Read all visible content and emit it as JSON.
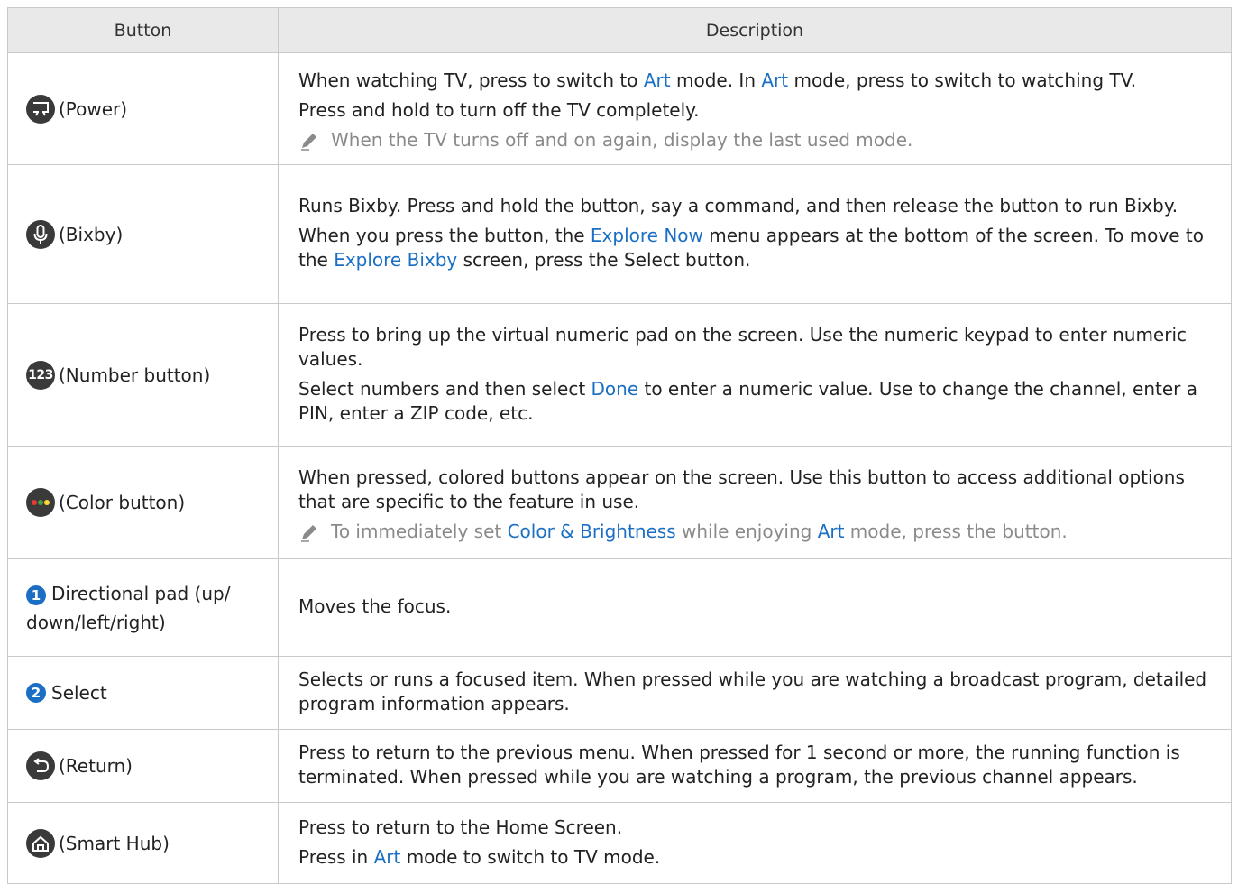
{
  "table": {
    "header": {
      "button": "Button",
      "description": "Description"
    },
    "rows": [
      {
        "button_label": "(Power)",
        "icon": "power-art-icon",
        "desc": [
          {
            "parts": [
              "When watching TV, press to switch to ",
              "Art",
              " mode. In ",
              "Art",
              " mode, press to switch to watching TV."
            ]
          },
          {
            "text": "Press and hold to turn off the TV completely."
          }
        ],
        "note": "When the TV turns off and on again, display the last used mode."
      },
      {
        "button_label": "(Bixby)",
        "icon": "microphone-icon",
        "desc": [
          {
            "text": "Runs Bixby. Press and hold the button, say a command, and then release the button to run Bixby."
          },
          {
            "parts": [
              "When you press the button, the ",
              "Explore Now",
              " menu appears at the bottom of the screen. To move to the ",
              "Explore Bixby",
              " screen, press the Select button."
            ]
          }
        ]
      },
      {
        "button_label": "(Number button)",
        "icon_text": "123",
        "desc": [
          {
            "text": "Press to bring up the virtual numeric pad on the screen. Use the numeric keypad to enter numeric values."
          },
          {
            "parts": [
              "Select numbers and then select ",
              "Done",
              " to enter a numeric value. Use to change the channel, enter a PIN, enter a ZIP code, etc."
            ]
          }
        ]
      },
      {
        "button_label": "(Color button)",
        "icon": "color-dots-icon",
        "desc": [
          {
            "text": "When pressed, colored buttons appear on the screen. Use this button to access additional options that are specific to the feature in use."
          }
        ],
        "note_parts": [
          "To immediately set ",
          "Color & Brightness",
          " while enjoying ",
          "Art",
          " mode, press the button."
        ]
      },
      {
        "button_label": "Directional pad (up/ down/left/right)",
        "badge": "1",
        "desc": [
          {
            "text": "Moves the focus."
          }
        ]
      },
      {
        "button_label": "Select",
        "badge": "2",
        "desc": [
          {
            "text": "Selects or runs a focused item. When pressed while you are watching a broadcast program, detailed program information appears."
          }
        ]
      },
      {
        "button_label": "(Return)",
        "icon": "return-arrow-icon",
        "desc": [
          {
            "text": "Press to return to the previous menu. When pressed for 1 second or more, the running function is terminated. When pressed while you are watching a program, the previous channel appears."
          }
        ]
      },
      {
        "button_label": "(Smart Hub)",
        "icon": "home-icon",
        "desc": [
          {
            "text": "Press to return to the Home Screen."
          },
          {
            "parts": [
              "Press in ",
              "Art",
              " mode to switch to TV mode."
            ]
          }
        ]
      }
    ]
  },
  "colors": {
    "highlight": "#1a6fc4",
    "header_bg": "#e9e9e9",
    "note": "#8a8a8a",
    "icon_bg": "#3a3a3a"
  }
}
